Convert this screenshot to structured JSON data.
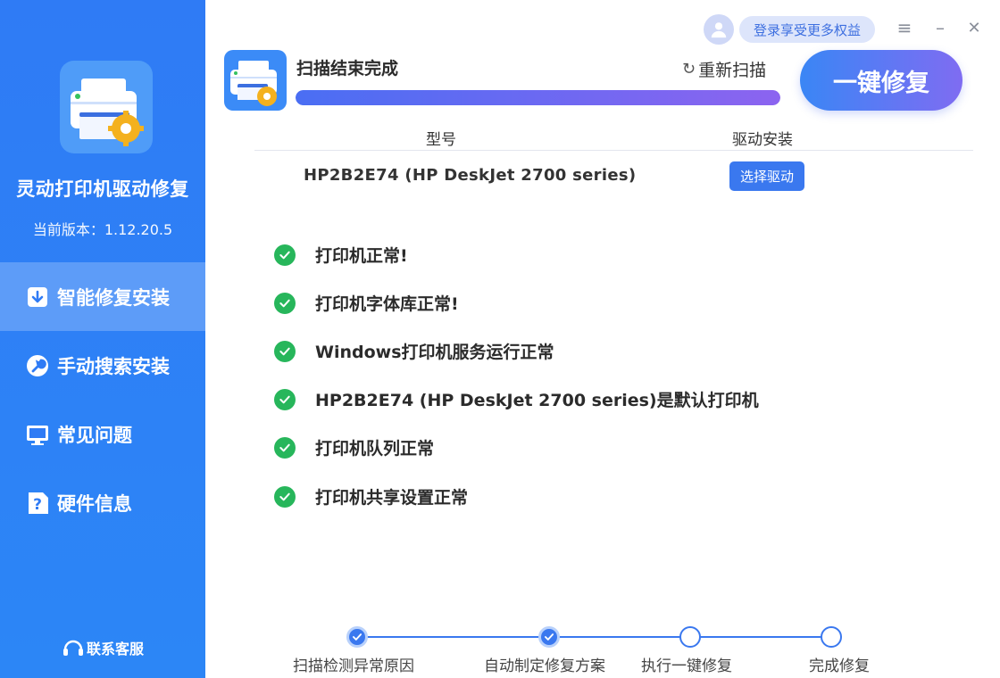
{
  "sidebar": {
    "app_name": "灵动打印机驱动修复",
    "version": "当前版本：1.12.20.5",
    "items": [
      {
        "label": "智能修复安装",
        "icon": "download-box-icon",
        "active": true
      },
      {
        "label": "手动搜索安装",
        "icon": "wrench-icon",
        "active": false
      },
      {
        "label": "常见问题",
        "icon": "monitor-icon",
        "active": false
      },
      {
        "label": "硬件信息",
        "icon": "question-doc-icon",
        "active": false
      }
    ],
    "contact": "联系客服"
  },
  "titlebar": {
    "login_label": "登录享受更多权益",
    "menu_icon": "≡",
    "minimize_icon": "–",
    "close_icon": "✕"
  },
  "scan": {
    "title": "扫描结束完成",
    "rescan_label": "重新扫描",
    "progress": 1.0,
    "fix_button": "一键修复"
  },
  "table": {
    "col_model": "型号",
    "col_driver": "驱动安装",
    "model": "HP2B2E74 (HP DeskJet 2700 series)",
    "choose_driver": "选择驱动"
  },
  "checks": [
    "打印机正常!",
    "打印机字体库正常!",
    "Windows打印机服务运行正常",
    "HP2B2E74 (HP DeskJet 2700 series)是默认打印机",
    "打印机队列正常",
    "打印机共享设置正常"
  ],
  "steps": [
    {
      "label": "扫描检测异常原因",
      "done": true
    },
    {
      "label": "自动制定修复方案",
      "done": true
    },
    {
      "label": "执行一键修复",
      "done": false
    },
    {
      "label": "完成修复",
      "done": false
    }
  ],
  "colors": {
    "sidebar": "#2f7bf5",
    "accent": "#3a78ef",
    "success": "#27b65b",
    "gradient_end": "#7f6cf2"
  }
}
